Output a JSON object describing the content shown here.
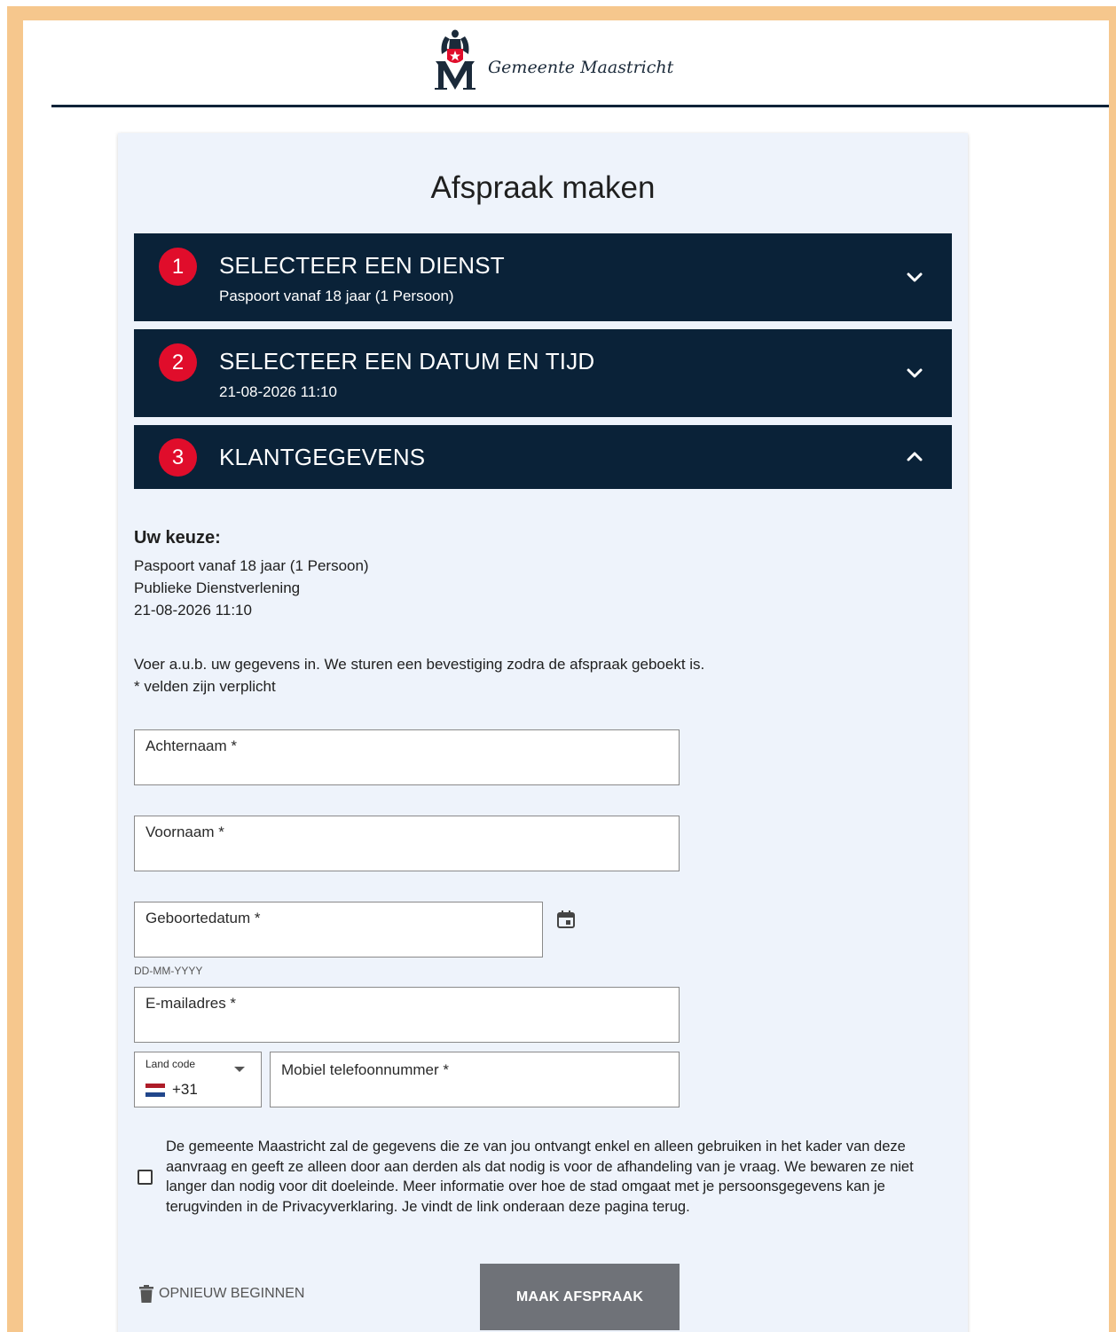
{
  "brand": {
    "name": "Gemeente Maastricht"
  },
  "page": {
    "title": "Afspraak maken"
  },
  "steps": [
    {
      "number": "1",
      "title": "SELECTEER EEN DIENST",
      "subtitle": "Paspoort vanaf 18 jaar (1 Persoon)",
      "state": "collapsed"
    },
    {
      "number": "2",
      "title": "SELECTEER EEN DATUM EN TIJD",
      "subtitle": "21-08-2026 11:10",
      "state": "collapsed"
    },
    {
      "number": "3",
      "title": "KLANTGEGEVENS",
      "subtitle": "",
      "state": "expanded"
    }
  ],
  "choice": {
    "heading": "Uw keuze:",
    "lines": [
      "Paspoort vanaf 18 jaar (1 Persoon)",
      "Publieke Dienstverlening",
      "21-08-2026 11:10"
    ]
  },
  "intro": {
    "line1": "Voer a.u.b. uw gegevens in. We sturen een bevestiging zodra de afspraak geboekt is.",
    "line2": "* velden zijn verplicht"
  },
  "form": {
    "lastname_label": "Achternaam *",
    "firstname_label": "Voornaam *",
    "birthdate_label": "Geboortedatum *",
    "birthdate_hint": "DD-MM-YYYY",
    "email_label": "E-mailadres *",
    "country_code_label": "Land code",
    "country_code_value": "+31",
    "phone_label": "Mobiel telefoonnummer *"
  },
  "consent": {
    "checked": false,
    "text": "De gemeente Maastricht zal de gegevens die ze van jou ontvangt enkel en alleen gebruiken in het kader van deze aanvraag en geeft ze alleen door aan derden als dat nodig is voor de afhandeling van je vraag. We bewaren ze niet langer dan nodig voor dit doeleinde. Meer informatie over hoe de stad omgaat met je persoonsgegevens kan je terugvinden in de Privacyverklaring. Je vindt de link onderaan deze pagina terug."
  },
  "actions": {
    "reset_label": "OPNIEUW BEGINNEN",
    "submit_label": "MAAK AFSPRAAK"
  },
  "colors": {
    "frame": "#f6c78d",
    "navy": "#0a2238",
    "badge_red": "#e00d2b",
    "card_bg": "#eef3fb",
    "submit_bg": "#6f7278"
  },
  "icons": {
    "chevrons": [
      "chevron-down-icon",
      "chevron-down-icon",
      "chevron-up-icon"
    ],
    "calendar": "calendar-icon",
    "trash": "trash-icon",
    "flag": "netherlands-flag-icon"
  }
}
